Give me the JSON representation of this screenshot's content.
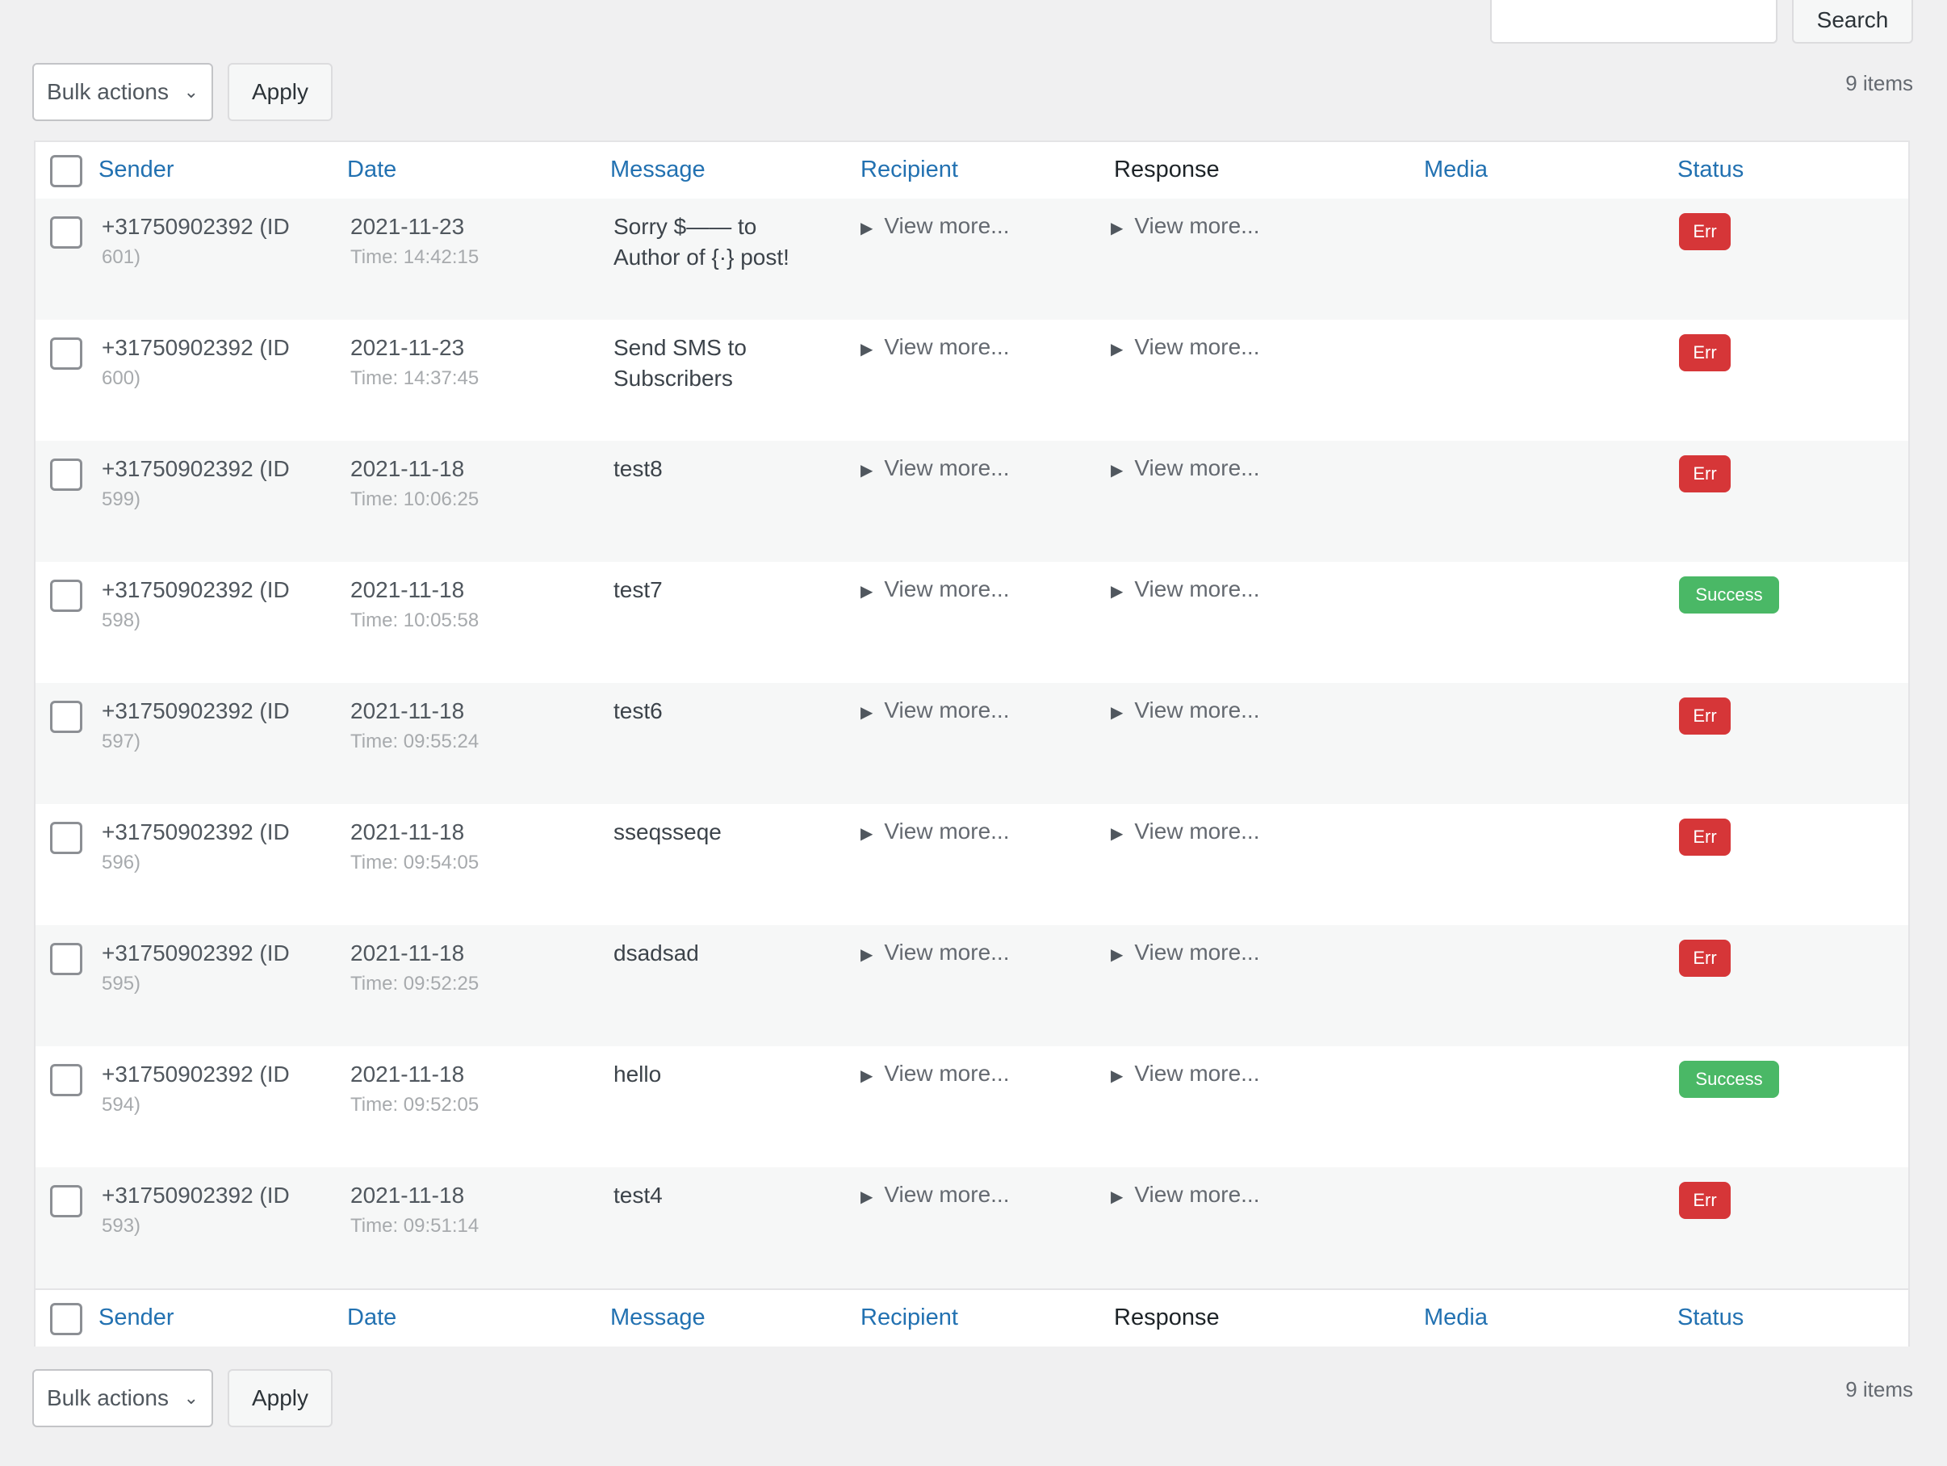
{
  "search": {
    "button_label": "Search",
    "value": ""
  },
  "top_nav": {
    "bulk_label": "Bulk actions",
    "apply_label": "Apply",
    "count": "9 items"
  },
  "bottom_nav": {
    "bulk_label": "Bulk actions",
    "apply_label": "Apply",
    "count": "9 items"
  },
  "columns": [
    "Sender",
    "Date",
    "Message",
    "Recipient",
    "Response",
    "Media",
    "Status"
  ],
  "rows": [
    {
      "sender": "+31750902392 (ID",
      "sender_sub": "601)",
      "date": "2021-11-23",
      "time": "Time: 14:42:15",
      "message": "Sorry $—— to Author of {·} post!",
      "recipient": "View more...",
      "response": "View more...",
      "status": "Err"
    },
    {
      "sender": "+31750902392 (ID",
      "sender_sub": "600)",
      "date": "2021-11-23",
      "time": "Time: 14:37:45",
      "message": "Send SMS to Subscribers",
      "recipient": "View more...",
      "response": "View more...",
      "status": "Err"
    },
    {
      "sender": "+31750902392 (ID",
      "sender_sub": "599)",
      "date": "2021-11-18",
      "time": "Time: 10:06:25",
      "message": "test8",
      "recipient": "View more...",
      "response": "View more...",
      "status": "Err"
    },
    {
      "sender": "+31750902392 (ID",
      "sender_sub": "598)",
      "date": "2021-11-18",
      "time": "Time: 10:05:58",
      "message": "test7",
      "recipient": "View more...",
      "response": "View more...",
      "status": "Success"
    },
    {
      "sender": "+31750902392 (ID",
      "sender_sub": "597)",
      "date": "2021-11-18",
      "time": "Time: 09:55:24",
      "message": "test6",
      "recipient": "View more...",
      "response": "View more...",
      "status": "Err"
    },
    {
      "sender": "+31750902392 (ID",
      "sender_sub": "596)",
      "date": "2021-11-18",
      "time": "Time: 09:54:05",
      "message": "sseqsseqe",
      "recipient": "View more...",
      "response": "View more...",
      "status": "Err"
    },
    {
      "sender": "+31750902392 (ID",
      "sender_sub": "595)",
      "date": "2021-11-18",
      "time": "Time: 09:52:25",
      "message": "dsadsad",
      "recipient": "View more...",
      "response": "View more...",
      "status": "Err"
    },
    {
      "sender": "+31750902392 (ID",
      "sender_sub": "594)",
      "date": "2021-11-18",
      "time": "Time: 09:52:05",
      "message": "hello",
      "recipient": "View more...",
      "response": "View more...",
      "status": "Success"
    },
    {
      "sender": "+31750902392 (ID",
      "sender_sub": "593)",
      "date": "2021-11-18",
      "time": "Time: 09:51:14",
      "message": "test4",
      "recipient": "View more...",
      "response": "View more...",
      "status": "Err"
    }
  ],
  "colors": {
    "link": "#2271b1",
    "error": "#d63638",
    "success": "#4ab866"
  }
}
